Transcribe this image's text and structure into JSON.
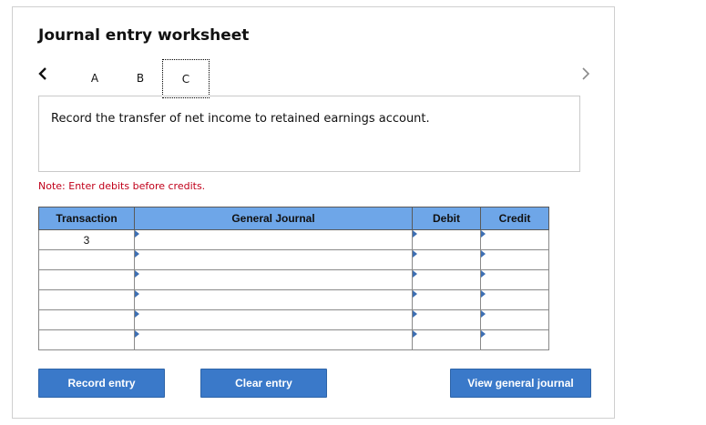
{
  "worksheet": {
    "title": "Journal entry worksheet"
  },
  "tabs": [
    {
      "label": "A"
    },
    {
      "label": "B"
    },
    {
      "label": "C"
    }
  ],
  "active_tab": "C",
  "instruction": "Record the transfer of net income to retained earnings account.",
  "note": "Note: Enter debits before credits.",
  "table": {
    "headers": [
      "Transaction",
      "General Journal",
      "Debit",
      "Credit"
    ],
    "rows": [
      {
        "transaction": "3",
        "account": "",
        "debit": "",
        "credit": ""
      },
      {
        "transaction": "",
        "account": "",
        "debit": "",
        "credit": ""
      },
      {
        "transaction": "",
        "account": "",
        "debit": "",
        "credit": ""
      },
      {
        "transaction": "",
        "account": "",
        "debit": "",
        "credit": ""
      },
      {
        "transaction": "",
        "account": "",
        "debit": "",
        "credit": ""
      },
      {
        "transaction": "",
        "account": "",
        "debit": "",
        "credit": ""
      }
    ]
  },
  "buttons": {
    "record": "Record entry",
    "clear": "Clear entry",
    "view": "View general journal"
  },
  "colors": {
    "header_bg": "#6ea6e8",
    "button_bg": "#3a79c9",
    "note_text": "#c0001a",
    "input_border": "#3d6fb3"
  },
  "icons": {
    "prev": "chevron-left-icon",
    "next": "chevron-right-icon"
  }
}
